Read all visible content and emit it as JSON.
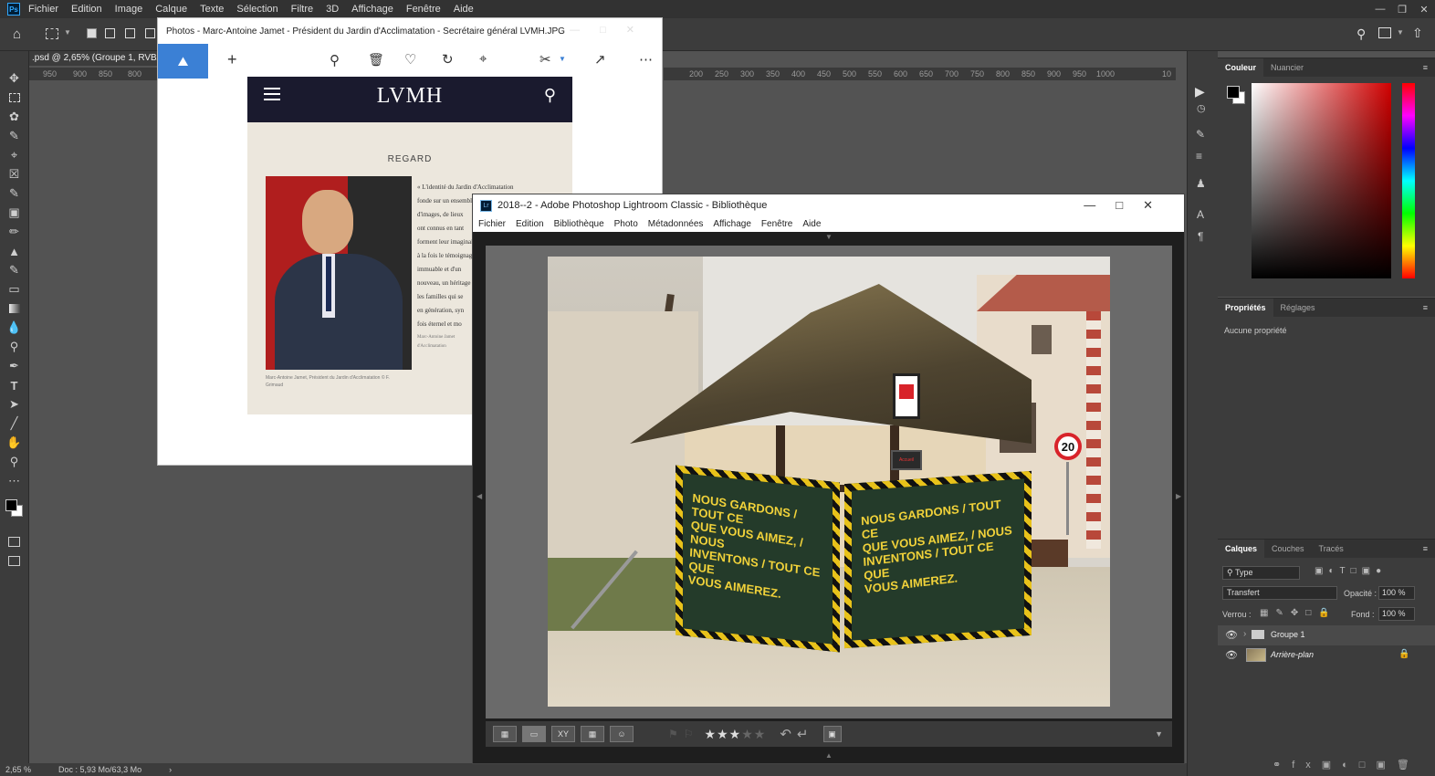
{
  "ps": {
    "logo": "Ps",
    "menus": [
      "Fichier",
      "Edition",
      "Image",
      "Calque",
      "Texte",
      "Sélection",
      "Filtre",
      "3D",
      "Affichage",
      "Fenêtre",
      "Aide"
    ],
    "doc_tab": ".psd @ 2,65% (Groupe 1, RVB/8#",
    "ruler_left": [
      "950",
      "900",
      "850",
      "800"
    ],
    "ruler_right": [
      "200",
      "250",
      "300",
      "350",
      "400",
      "450",
      "500",
      "550",
      "600",
      "650",
      "700",
      "750",
      "800",
      "850",
      "900",
      "950",
      "1000",
      "10"
    ],
    "status_zoom": "2,65 %",
    "status_doc": "Doc : 5,93 Mo/63,3 Mo",
    "color_panel": {
      "tab1": "Couleur",
      "tab2": "Nuancier"
    },
    "props_panel": {
      "tab1": "Propriétés",
      "tab2": "Réglages",
      "empty": "Aucune propriété"
    },
    "layers_panel": {
      "tab1": "Calques",
      "tab2": "Couches",
      "tab3": "Tracés",
      "filter": "Type",
      "blend": "Transfert",
      "opacity_label": "Opacité :",
      "opacity_value": "100 %",
      "lock_label": "Verrou :",
      "fill_label": "Fond :",
      "fill_value": "100 %",
      "layers": [
        {
          "name": "Groupe 1",
          "kind": "folder"
        },
        {
          "name": "Arrière-plan",
          "kind": "image"
        }
      ]
    }
  },
  "photos": {
    "title": "Photos - Marc-Antoine Jamet - Président du Jardin d'Acclimatation - Secrétaire général LVMH.JPG",
    "page": {
      "brand": "LVMH",
      "section": "REGARD",
      "text_lines": [
        "« L'identité du Jardin d'Acclimatation",
        "fonde sur un ensemble",
        "d'images, de lieux",
        "ont connus en tant",
        "forment leur imaginaire",
        "à la fois le témoignage",
        "immuable et d'un",
        "nouveau, un héritage",
        "les familles qui se",
        "en génération, syn",
        "fois éternel et mo"
      ],
      "byline": [
        "Marc-Antoine Jamet",
        "d'Acclimatation"
      ],
      "caption": [
        "Marc-Antoine Jamet, Président du Jardin d'Acclimatation © F.",
        "Grimaud"
      ]
    }
  },
  "lr": {
    "title": "2018--2 - Adobe Photoshop Lightroom Classic - Bibliothèque",
    "logo": "Lr",
    "menus": [
      "Fichier",
      "Edition",
      "Bibliothèque",
      "Photo",
      "Métadonnées",
      "Affichage",
      "Fenêtre",
      "Aide"
    ],
    "banner1": [
      "NOUS GARDONS / TOUT CE",
      "QUE VOUS AIMEZ, / NOUS",
      "INVENTONS / TOUT CE QUE",
      "VOUS AIMEREZ."
    ],
    "banner2": [
      "NOUS GARDONS / TOUT CE",
      "QUE VOUS AIMEZ, / NOUS",
      "INVENTONS / TOUT CE QUE",
      "VOUS AIMEREZ."
    ],
    "sign_speed": "20",
    "sign_small": "Accueil",
    "rating": 3,
    "rating_max": 5
  }
}
